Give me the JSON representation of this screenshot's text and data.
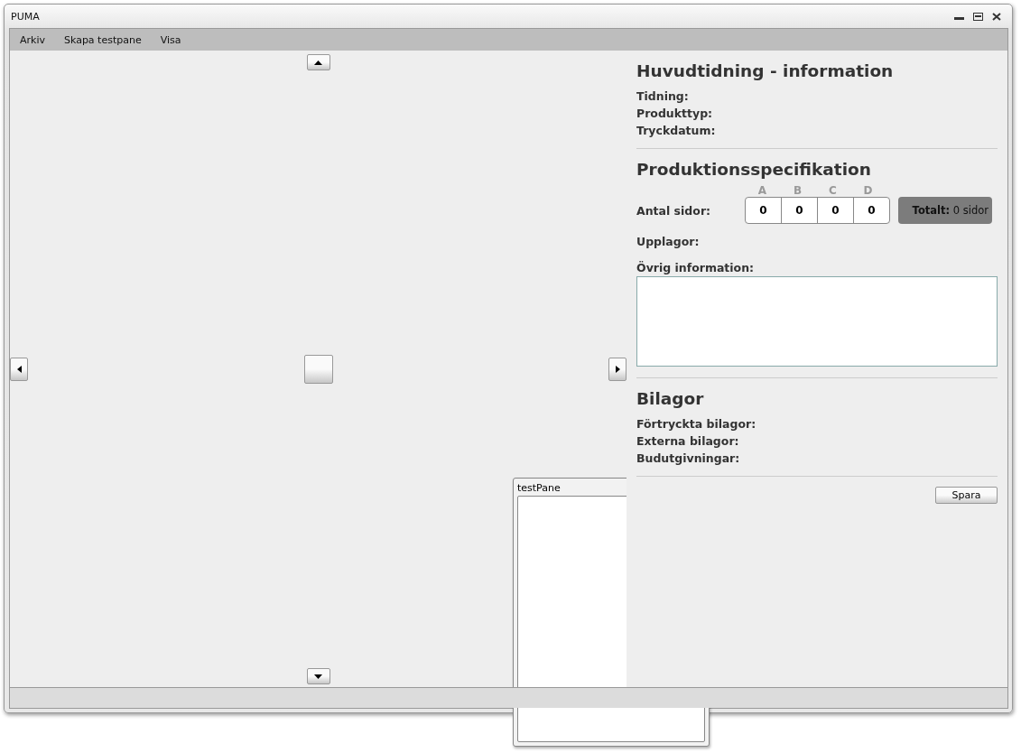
{
  "window": {
    "title": "PUMA"
  },
  "menu": [
    "Arkiv",
    "Skapa testpane",
    "Visa"
  ],
  "info": {
    "heading": "Huvudtidning - information",
    "fields": [
      "Tidning:",
      "Produkttyp:",
      "Tryckdatum:"
    ]
  },
  "production": {
    "heading": "Produktionsspecifikation",
    "pages_label": "Antal sidor:",
    "parts": [
      {
        "letter": "A",
        "value": "0"
      },
      {
        "letter": "B",
        "value": "0"
      },
      {
        "letter": "C",
        "value": "0"
      },
      {
        "letter": "D",
        "value": "0"
      }
    ],
    "total_label": "Totalt:",
    "total_value": "0 sidor",
    "editions_label": "Upplagor:",
    "other_label": "Övrig information:"
  },
  "supplements": {
    "heading": "Bilagor",
    "fields": [
      "Förtryckta bilagor:",
      "Externa bilagor:",
      "Budutgivningar:"
    ]
  },
  "save_button": "Spara",
  "test_pane": {
    "title": "testPane"
  }
}
